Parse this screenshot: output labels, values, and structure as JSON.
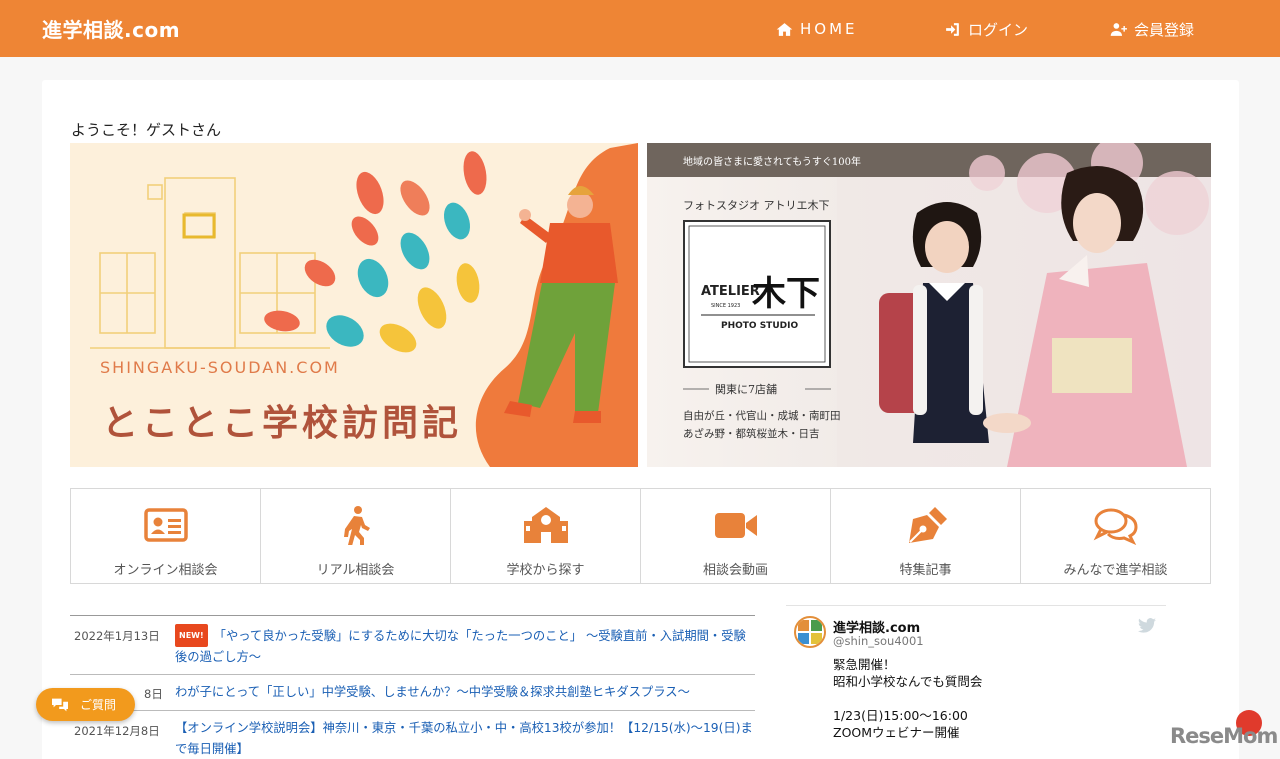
{
  "nav": {
    "brand": "進学相談.com",
    "home": "HOME",
    "login": "ログイン",
    "register": "会員登録"
  },
  "welcome": "ようこそ！ゲストさん",
  "banners": {
    "left": {
      "site": "SHINGAKU-SOUDAN.COM",
      "title": "とことこ学校訪問記"
    },
    "right": {
      "tagline": "地域の皆さまに愛されてもうすぐ100年",
      "studio_name": "フォトスタジオ アトリエ木下",
      "logo_word": "ATELIER",
      "logo_since": "SINCE 1923",
      "logo_kanji": "木下",
      "logo_sub": "PHOTO STUDIO",
      "stores_heading": "関東に7店舗",
      "stores_line1": "自由が丘・代官山・成城・南町田",
      "stores_line2": "あざみ野・都筑桜並木・日吉"
    }
  },
  "categories": [
    {
      "label": "オンライン相談会",
      "icon": "id-card-icon"
    },
    {
      "label": "リアル相談会",
      "icon": "walking-icon"
    },
    {
      "label": "学校から探す",
      "icon": "school-icon"
    },
    {
      "label": "相談会動画",
      "icon": "video-icon"
    },
    {
      "label": "特集記事",
      "icon": "pen-nib-icon"
    },
    {
      "label": "みんなで進学相談",
      "icon": "comments-icon"
    }
  ],
  "news": [
    {
      "date": "2022年1月13日",
      "badge": "NEW!",
      "title": "「やって良かった受験」にするために大切な「たった一つのこと」 〜受験直前・入試期間・受験後の過ごし方〜"
    },
    {
      "date": "8日",
      "title": "わが子にとって「正しい」中学受験、しませんか？〜中学受験＆探求共創塾ヒキダスプラス〜"
    },
    {
      "date": "2021年12月8日",
      "title": "【オンライン学校説明会】神奈川・東京・千葉の私立小・中・高校13校が参加！【12/15(水)〜19(日)まで毎日開催】"
    }
  ],
  "tweet": {
    "name": "進学相談.com",
    "handle": "@shin_sou4001",
    "line1": "緊急開催！",
    "line2": "昭和小学校なんでも質問会",
    "line3": "1/23(日)15:00〜16:00",
    "line4": "ZOOMウェビナー開催"
  },
  "question_button": "ご質問",
  "watermark": "ReseMom",
  "colors": {
    "brand_orange": "#ee8535",
    "link_blue": "#1a5fb4",
    "icon_orange": "#e8823a",
    "button_orange": "#f29a1d"
  }
}
